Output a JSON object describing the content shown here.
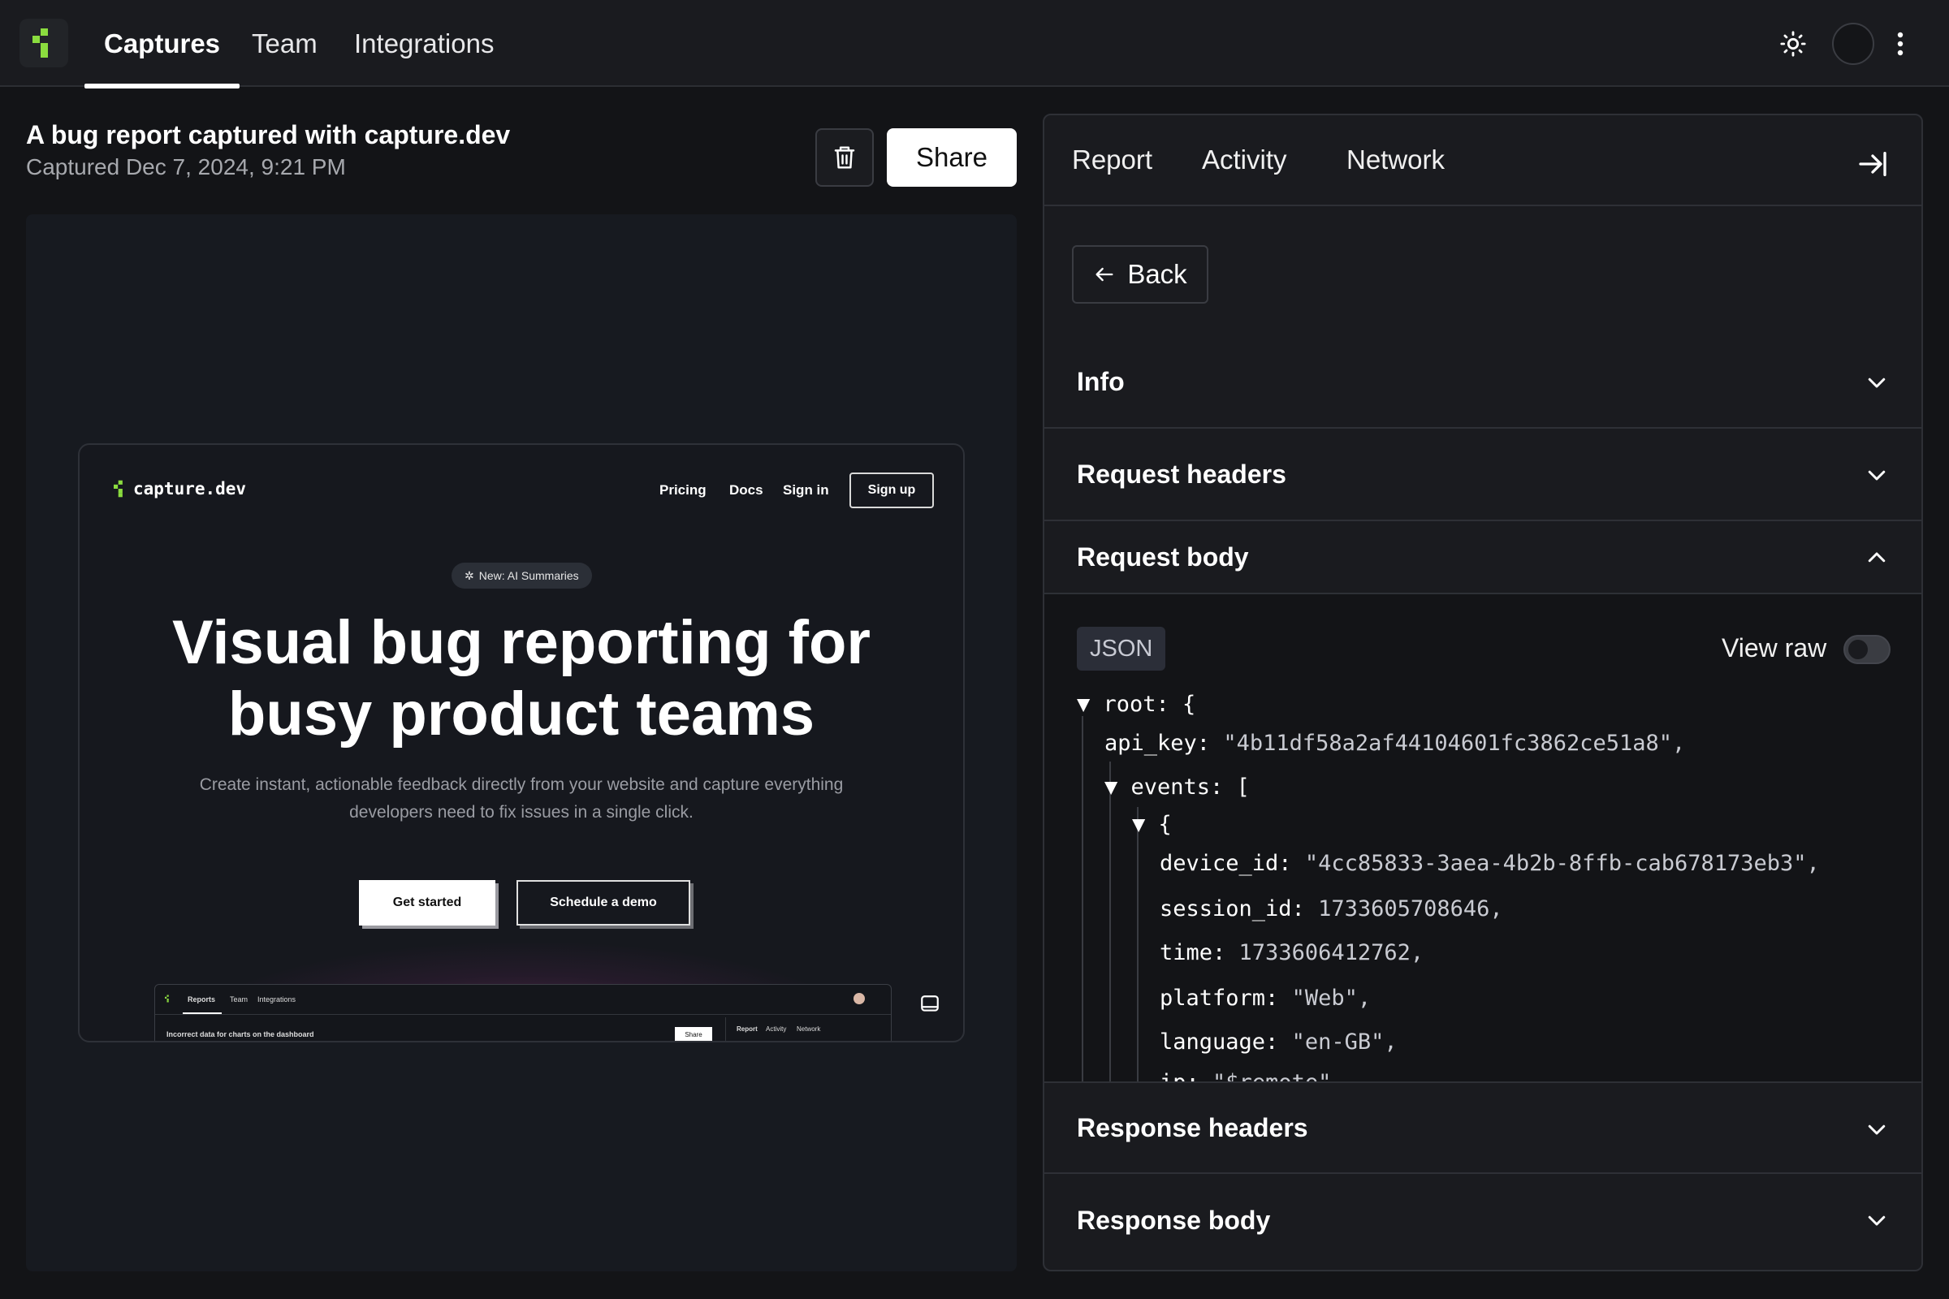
{
  "topbar": {
    "tabs": [
      "Captures",
      "Team",
      "Integrations"
    ],
    "active_tab": "Captures"
  },
  "capture": {
    "title": "A bug report captured with capture.dev",
    "date": "Captured Dec 7, 2024, 9:21 PM",
    "share_label": "Share"
  },
  "preview": {
    "logo_text": "capture.dev",
    "nav": [
      "Pricing",
      "Docs",
      "Sign in"
    ],
    "signup": "Sign up",
    "badge": "New: AI Summaries",
    "headline_line1": "Visual bug reporting for",
    "headline_line2": "busy product teams",
    "sub_line1": "Create instant, actionable feedback directly from your website and capture everything",
    "sub_line2": "developers need to fix issues in a single click.",
    "cta_primary": "Get started",
    "cta_secondary": "Schedule a demo",
    "mini": {
      "tabs": [
        "Reports",
        "Team",
        "Integrations"
      ],
      "title": "Incorrect data for charts on the dashboard",
      "share": "Share",
      "panel_tabs": [
        "Report",
        "Activity",
        "Network"
      ]
    }
  },
  "panel": {
    "tabs": [
      "Report",
      "Activity",
      "Network"
    ],
    "back_label": "Back",
    "sections": {
      "info": "Info",
      "request_headers": "Request headers",
      "request_body": "Request body",
      "response_headers": "Response headers",
      "response_body": "Response body"
    },
    "json_badge": "JSON",
    "view_raw": "View raw",
    "view_raw_on": false,
    "json": {
      "root_key": "root:",
      "api_key_key": "api_key:",
      "api_key_val": "\"4b11df58a2af44104601fc3862ce51a8\",",
      "events_key": "events:",
      "device_id_key": "device_id:",
      "device_id_val": "\"4cc85833-3aea-4b2b-8ffb-cab678173eb3\",",
      "session_id_key": "session_id:",
      "session_id_val": "1733605708646,",
      "time_key": "time:",
      "time_val": "1733606412762,",
      "platform_key": "platform:",
      "platform_val": "\"Web\",",
      "language_key": "language:",
      "language_val": "\"en-GB\",",
      "ip_key": "ip:",
      "ip_val": "\"$remote\""
    }
  },
  "colors": {
    "accent_green": "#8bdc3f",
    "background": "#131417"
  }
}
